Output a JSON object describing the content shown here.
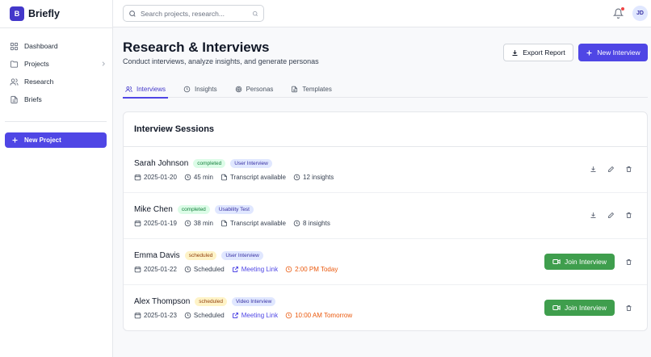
{
  "app": {
    "logo_letter": "B",
    "name": "Briefly"
  },
  "sidebar": {
    "items": [
      {
        "label": "Dashboard",
        "icon": "dashboard-icon"
      },
      {
        "label": "Projects",
        "icon": "folder-icon"
      },
      {
        "label": "Research",
        "icon": "users-icon"
      },
      {
        "label": "Briefs",
        "icon": "document-icon"
      }
    ],
    "new_project_label": "New Project"
  },
  "topbar": {
    "search_placeholder": "Search projects, research...",
    "avatar_initials": "JD"
  },
  "page": {
    "title": "Research & Interviews",
    "subtitle": "Conduct interviews, analyze insights, and generate personas",
    "export_label": "Export Report",
    "new_interview_label": "New Interview"
  },
  "tabs": [
    {
      "label": "Interviews",
      "active": true
    },
    {
      "label": "Insights",
      "active": false
    },
    {
      "label": "Personas",
      "active": false
    },
    {
      "label": "Templates",
      "active": false
    }
  ],
  "sessions": {
    "title": "Interview Sessions",
    "join_label": "Join Interview",
    "rows": [
      {
        "name": "Sarah Johnson",
        "status": "completed",
        "type": "User Interview",
        "date": "2025-01-20",
        "duration": "45 min",
        "transcript": "Transcript available",
        "insights": "12 insights"
      },
      {
        "name": "Mike Chen",
        "status": "completed",
        "type": "Usability Test",
        "date": "2025-01-19",
        "duration": "38 min",
        "transcript": "Transcript available",
        "insights": "8 insights"
      },
      {
        "name": "Emma Davis",
        "status": "scheduled",
        "type": "User Interview",
        "date": "2025-01-22",
        "duration": "Scheduled",
        "link": "Meeting Link",
        "time": "2:00 PM Today"
      },
      {
        "name": "Alex Thompson",
        "status": "scheduled",
        "type": "Video Interview",
        "date": "2025-01-23",
        "duration": "Scheduled",
        "link": "Meeting Link",
        "time": "10:00 AM Tomorrow"
      }
    ]
  },
  "colors": {
    "accent": "#4f46e5",
    "join_green": "#3f9e4d",
    "link": "#4f46e5",
    "time": "#ea580c"
  }
}
